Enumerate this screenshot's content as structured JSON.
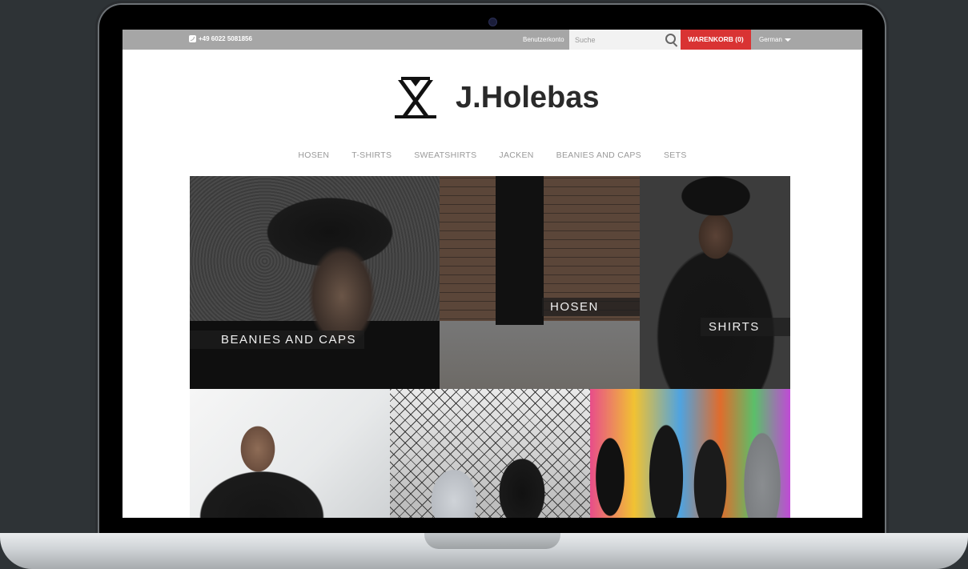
{
  "topbar": {
    "phone": "+49 6022 5081856",
    "account_label": "Benutzerkonto",
    "search_placeholder": "Suche",
    "cart_label": "WARENKORB (0)",
    "language": "German"
  },
  "brand": {
    "name": "J.Holebas"
  },
  "nav": {
    "items": [
      {
        "label": "HOSEN"
      },
      {
        "label": "T-SHIRTS"
      },
      {
        "label": "SWEATSHIRTS"
      },
      {
        "label": "JACKEN"
      },
      {
        "label": "BEANIES AND CAPS"
      },
      {
        "label": "SETS"
      }
    ]
  },
  "tiles": {
    "caps": {
      "label": "BEANIES AND CAPS"
    },
    "hosen": {
      "label": "HOSEN"
    },
    "shirts": {
      "label": "SHIRTS"
    }
  },
  "colors": {
    "topbar": "#a6a6a6",
    "cart": "#d93333",
    "nav_text": "#999999",
    "brand_text": "#2a2a2a"
  }
}
